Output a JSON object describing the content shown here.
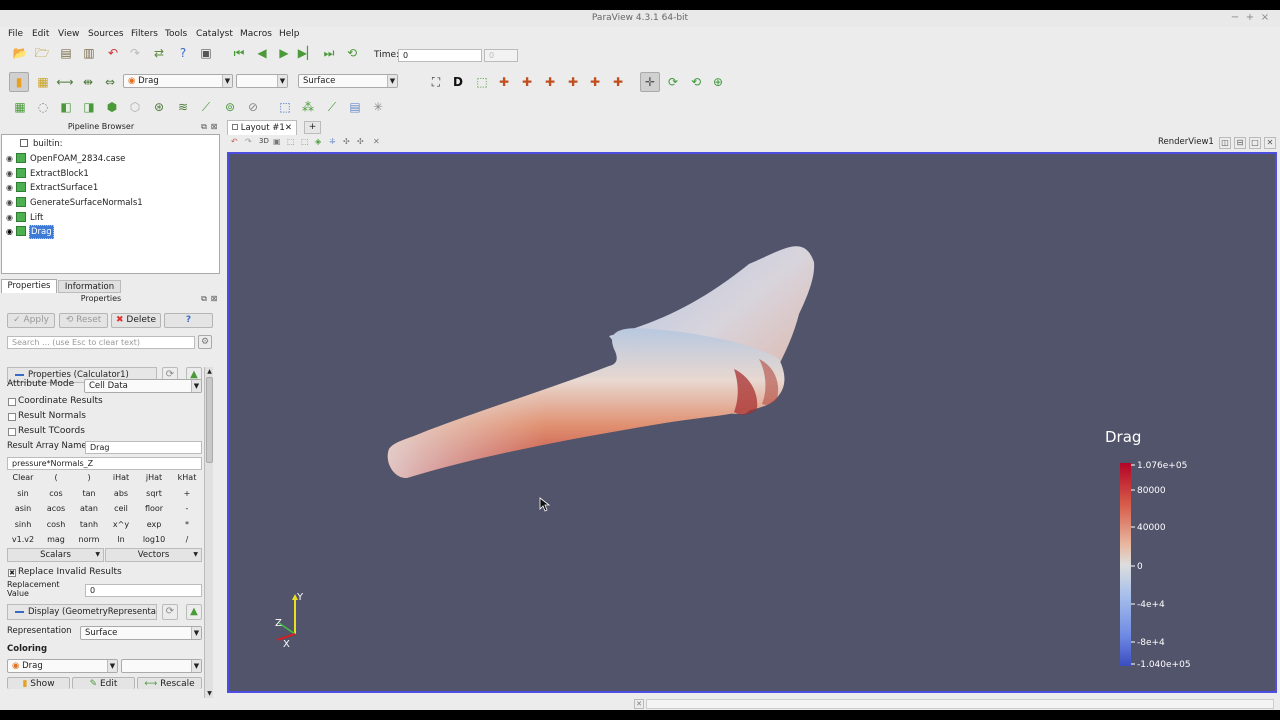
{
  "window": {
    "title": "ParaView 4.3.1 64-bit",
    "controls": [
      "−",
      "+",
      "×"
    ]
  },
  "menu": [
    "File",
    "Edit",
    "View",
    "Sources",
    "Filters",
    "Tools",
    "Catalyst",
    "Macros",
    "Help"
  ],
  "time": {
    "label": "Time:",
    "value": "0",
    "index": "0"
  },
  "toolbar2": {
    "array_combo": "Drag",
    "component_combo": "",
    "representation_combo": "Surface"
  },
  "pipeline": {
    "title": "Pipeline Browser",
    "items": [
      {
        "label": "builtin:",
        "eye": false
      },
      {
        "label": "OpenFOAM_2834.case",
        "eye": true
      },
      {
        "label": "ExtractBlock1",
        "eye": true
      },
      {
        "label": "ExtractSurface1",
        "eye": true
      },
      {
        "label": "GenerateSurfaceNormals1",
        "eye": true
      },
      {
        "label": "Lift",
        "eye": true
      },
      {
        "label": "Drag",
        "eye": true,
        "selected": true
      }
    ]
  },
  "tabs": {
    "properties": "Properties",
    "information": "Information"
  },
  "properties": {
    "title": "Properties",
    "apply": "Apply",
    "reset": "Reset",
    "delete": "Delete",
    "help": "?",
    "search_placeholder": "Search ... (use Esc to clear text)",
    "section_props": "Properties (Calculator1)",
    "attribute_mode_label": "Attribute Mode",
    "attribute_mode_value": "Cell Data",
    "coordinate_results": "Coordinate Results",
    "result_normals": "Result Normals",
    "result_tcoords": "Result TCoords",
    "result_array_name_label": "Result Array Name",
    "result_array_name_value": "Drag",
    "expression": "pressure*Normals_Z",
    "calc_rows": [
      [
        "Clear",
        "(",
        ")",
        "iHat",
        "jHat",
        "kHat"
      ],
      [
        "sin",
        "cos",
        "tan",
        "abs",
        "sqrt",
        "+"
      ],
      [
        "asin",
        "acos",
        "atan",
        "ceil",
        "floor",
        "-"
      ],
      [
        "sinh",
        "cosh",
        "tanh",
        "x^y",
        "exp",
        "*"
      ],
      [
        "v1.v2",
        "mag",
        "norm",
        "ln",
        "log10",
        "/"
      ]
    ],
    "scalars": "Scalars",
    "vectors": "Vectors",
    "replace_invalid": "Replace Invalid Results",
    "replacement_label_1": "Replacement",
    "replacement_label_2": "Value",
    "replacement_value": "0",
    "section_display": "Display (GeometryRepresentat",
    "representation_label": "Representation",
    "representation_value": "Surface",
    "coloring_label": "Coloring",
    "coloring_value": "Drag",
    "show": "Show",
    "edit": "Edit",
    "rescale": "Rescale"
  },
  "layout": {
    "tab": "Layout #1",
    "add": "+",
    "view_name": "RenderView1"
  },
  "colorbar": {
    "title": "Drag",
    "labels": [
      "1.076e+05",
      "80000",
      "40000",
      "0",
      "-4e+4",
      "-8e+4",
      "-1.040e+05"
    ],
    "top_color": "#b40426",
    "mid_color": "#dddddd",
    "bottom_color": "#3b4cc0"
  },
  "axes": {
    "x": "X",
    "y": "Y",
    "z": "Z"
  }
}
